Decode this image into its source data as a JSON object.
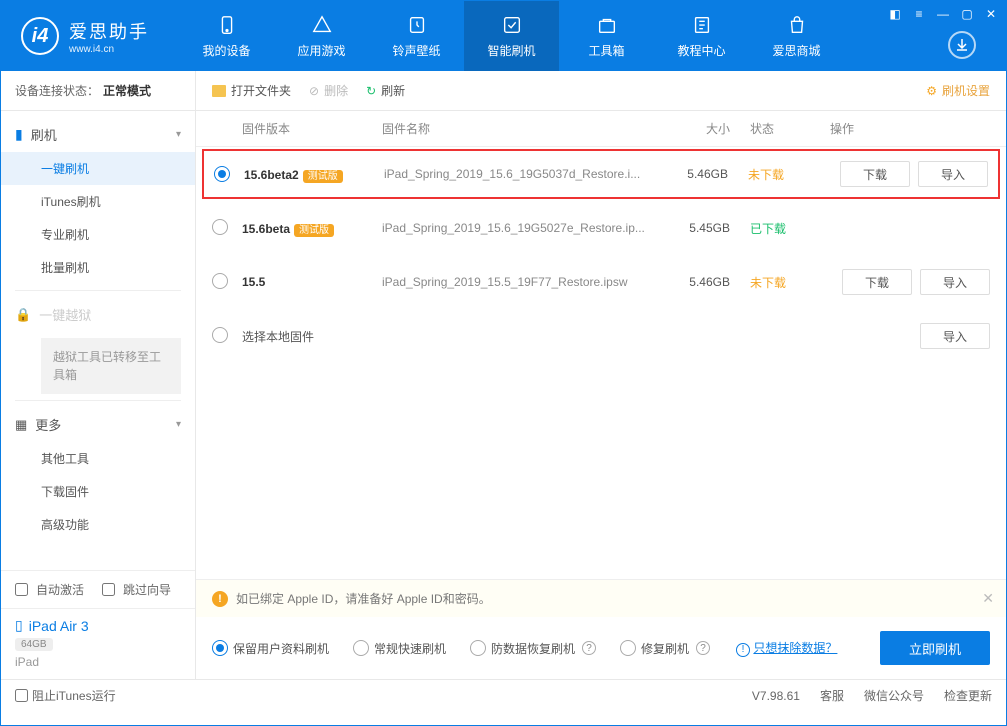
{
  "app": {
    "title": "爱思助手",
    "subtitle": "www.i4.cn"
  },
  "topnav": [
    {
      "label": "我的设备"
    },
    {
      "label": "应用游戏"
    },
    {
      "label": "铃声壁纸"
    },
    {
      "label": "智能刷机"
    },
    {
      "label": "工具箱"
    },
    {
      "label": "教程中心"
    },
    {
      "label": "爱思商城"
    }
  ],
  "sidebar": {
    "conn_label": "设备连接状态：",
    "conn_value": "正常模式",
    "flash_group": "刷机",
    "flash_items": [
      "一键刷机",
      "iTunes刷机",
      "专业刷机",
      "批量刷机"
    ],
    "jailbreak": "一键越狱",
    "jailbreak_note": "越狱工具已转移至工具箱",
    "more": "更多",
    "more_items": [
      "其他工具",
      "下载固件",
      "高级功能"
    ],
    "auto_activate": "自动激活",
    "skip_guide": "跳过向导",
    "device_name": "iPad Air 3",
    "device_storage": "64GB",
    "device_type": "iPad"
  },
  "toolbar": {
    "open": "打开文件夹",
    "delete": "删除",
    "refresh": "刷新",
    "settings": "刷机设置"
  },
  "headers": {
    "version": "固件版本",
    "name": "固件名称",
    "size": "大小",
    "status": "状态",
    "ops": "操作"
  },
  "firmware": [
    {
      "version": "15.6beta2",
      "beta": "测试版",
      "name": "iPad_Spring_2019_15.6_19G5037d_Restore.i...",
      "size": "5.46GB",
      "status": "未下载",
      "status_cls": "nd",
      "selected": true,
      "show_ops": true,
      "highlight": true
    },
    {
      "version": "15.6beta",
      "beta": "测试版",
      "name": "iPad_Spring_2019_15.6_19G5027e_Restore.ip...",
      "size": "5.45GB",
      "status": "已下载",
      "status_cls": "dl",
      "selected": false,
      "show_ops": false
    },
    {
      "version": "15.5",
      "beta": "",
      "name": "iPad_Spring_2019_15.5_19F77_Restore.ipsw",
      "size": "5.46GB",
      "status": "未下载",
      "status_cls": "nd",
      "selected": false,
      "show_ops": true
    }
  ],
  "local_select": "选择本地固件",
  "ops": {
    "download": "下载",
    "import": "导入"
  },
  "warning": "如已绑定 Apple ID，请准备好 Apple ID和密码。",
  "flash_options": [
    "保留用户资料刷机",
    "常规快速刷机",
    "防数据恢复刷机",
    "修复刷机"
  ],
  "erase_link": "只想抹除数据？",
  "flash_now": "立即刷机",
  "statusbar": {
    "block_itunes": "阻止iTunes运行",
    "version": "V7.98.61",
    "service": "客服",
    "wechat": "微信公众号",
    "update": "检查更新"
  }
}
